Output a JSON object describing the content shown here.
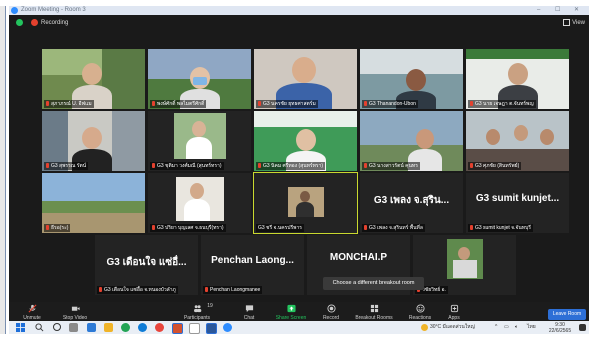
{
  "window": {
    "title": "Zoom Meeting - Room 3",
    "minimize": "–",
    "maximize": "☐",
    "close": "✕"
  },
  "infobar": {
    "recording": "Recording",
    "view": "View"
  },
  "tiles": [
    {
      "name": "สุภาภรณ์ U. อีฟแม"
    },
    {
      "name": "พงษ์ศักดิ์ พลไมตรีศักดิ์"
    },
    {
      "name": "G3 นครชัย ยุทธศาสตร์ม"
    },
    {
      "name": "G3 Thanandon-Ubon"
    },
    {
      "name": "G3 นาย เจษฎา ต.จันทร์พญ"
    },
    {
      "name": "G3 สุพรรณ รัตน์"
    },
    {
      "name": "G3 ชุติมา วงศ์มณี (สุนทร์ทรา)"
    },
    {
      "name": "G3 นิคม ศรีทอง (สุนทร์ทรา)"
    },
    {
      "name": "G3 นางสาวรัตน์ คุนทร"
    },
    {
      "name": "G3 ศุภชัย (สินทรัพย์)"
    },
    {
      "name": "ธีรอ(ระ)"
    },
    {
      "name": "G3 ปริยา บุญเลศ จ.ธนบุรี(ทรา)"
    },
    {
      "name": "G3 ชรี จ.นครปรีพาร"
    },
    {
      "name": "G3 เพลง จ.สุรินทร์ พื้นที่ล",
      "big": "G3 เพลง จ.สุริน..."
    },
    {
      "name": "G3 sumit kunjet จ.จันทบุรี",
      "big": "G3 sumit kunjet..."
    },
    {
      "name": "G3 เดือนใจ แซ่อื้อ จ.หนองบัวลำภู",
      "big": "G3 เดือนใจ แซ่อื่..."
    },
    {
      "name": "Penchan Laongmanee",
      "big": "Penchan Laong..."
    },
    {
      "name": "MONCHAI.P",
      "big": "MONCHAI.P"
    },
    {
      "name": "วิชัยวิทย์ อ."
    }
  ],
  "tooltip": "Choose a different breakout room",
  "toolbar": {
    "unmute": "Unmute",
    "stop_video": "Stop Video",
    "participants": "Participants",
    "participants_count": "19",
    "chat": "Chat",
    "share": "Share Screen",
    "record": "Record",
    "breakout": "Breakout Rooms",
    "reactions": "Reactions",
    "apps": "Apps",
    "leave": "Leave Room"
  },
  "taskbar": {
    "weather": "30°C มีแดดส่วนใหญ่",
    "lang": "ไทย",
    "time": "9:30",
    "date": "22/6/2565"
  },
  "colors": {
    "accent_green": "#23c45e",
    "leave_blue": "#2d6fd6",
    "active_speaker": "#c9d82f",
    "recording_red": "#e4412e"
  }
}
